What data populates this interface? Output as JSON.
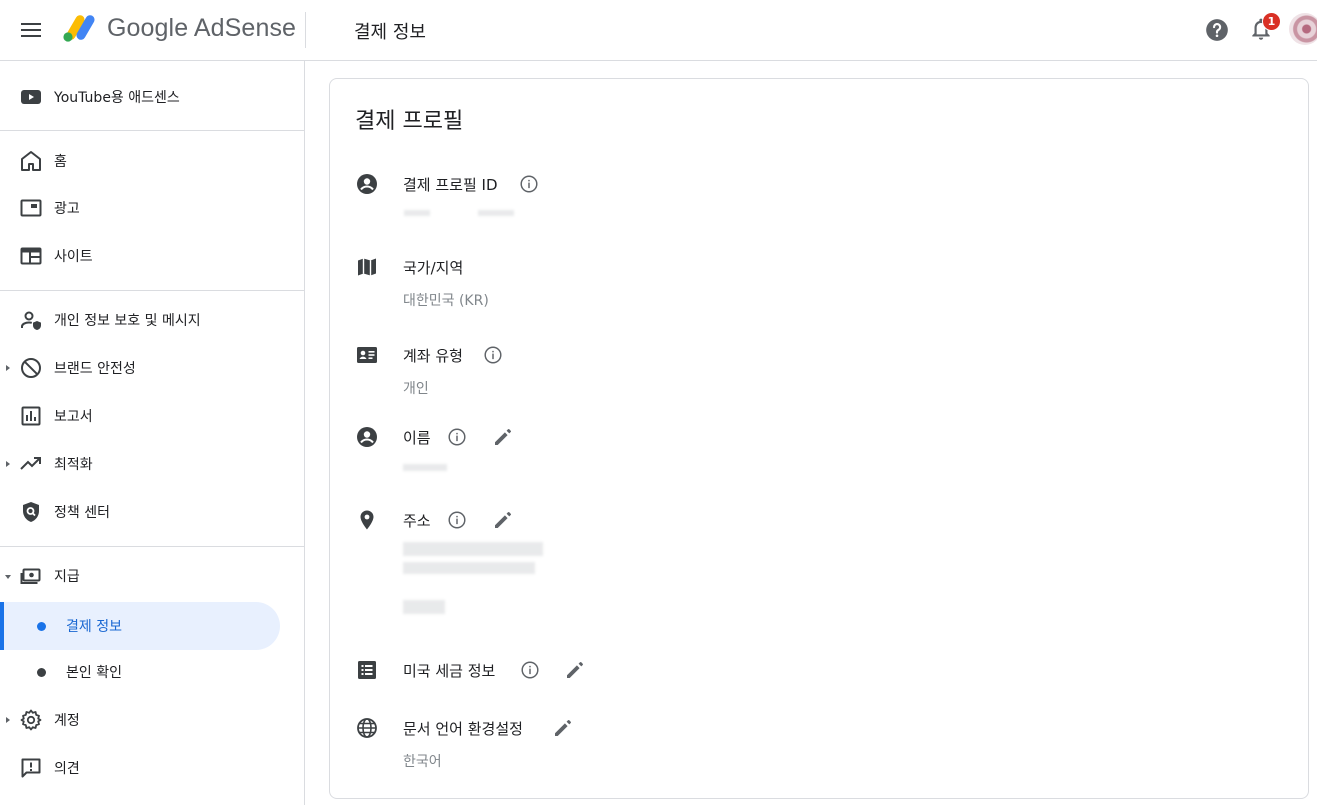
{
  "header": {
    "brand": "Google AdSense",
    "title": "결제 정보",
    "notification_count": "1"
  },
  "sidebar": {
    "youtube": "YouTube용 애드센스",
    "items": {
      "home": "홈",
      "ads": "광고",
      "sites": "사이트",
      "privacy": "개인 정보 보호 및 메시지",
      "brand_safety": "브랜드 안전성",
      "reports": "보고서",
      "optimization": "최적화",
      "policy_center": "정책 센터",
      "payments": "지급",
      "payments_info": "결제 정보",
      "verification": "본인 확인",
      "account": "계정",
      "feedback": "의견"
    }
  },
  "main": {
    "title": "결제 프로필",
    "fields": {
      "profile_id": {
        "label": "결제 프로필 ID"
      },
      "country": {
        "label": "국가/지역",
        "value": "대한민국 (KR)"
      },
      "account_type": {
        "label": "계좌 유형",
        "value": "개인"
      },
      "name": {
        "label": "이름"
      },
      "address": {
        "label": "주소"
      },
      "us_tax": {
        "label": "미국 세금 정보"
      },
      "doc_lang": {
        "label": "문서 언어 환경설정",
        "value": "한국어"
      }
    }
  },
  "colors": {
    "accent": "#1a73e8",
    "active_bg": "#e8f0fe",
    "badge": "#d93025",
    "icon": "#5f6368"
  }
}
